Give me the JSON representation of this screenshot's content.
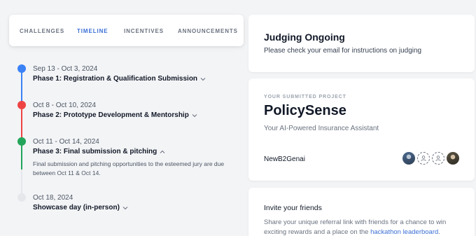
{
  "tabs": [
    {
      "label": "CHALLENGES",
      "active": false
    },
    {
      "label": "TIMELINE",
      "active": true
    },
    {
      "label": "INCENTIVES",
      "active": false
    },
    {
      "label": "ANNOUNCEMENTS",
      "active": false
    }
  ],
  "timeline": {
    "phases": [
      {
        "date": "Sep 13 - Oct 3, 2024",
        "title": "Phase 1: Registration & Qualification Submission",
        "status_color": "#3b82f6",
        "expanded": false
      },
      {
        "date": "Oct 8 - Oct 10, 2024",
        "title": "Phase 2: Prototype Development & Mentorship",
        "status_color": "#ef4444",
        "expanded": false
      },
      {
        "date": "Oct 11 - Oct 14, 2024",
        "title": "Phase 3: Final submission & pitching",
        "status_color": "#22a55a",
        "expanded": true,
        "description": "Final submission and pitching opportunities to the esteemed jury are due between Oct 11 & Oct 14."
      },
      {
        "date": "Oct 18, 2024",
        "title": "Showcase day (in-person)",
        "status_color": "#e5e7eb",
        "expanded": false
      }
    ]
  },
  "judging": {
    "title": "Judging Ongoing",
    "subtitle": "Please check your email for instructions on judging"
  },
  "project": {
    "label": "YOUR SUBMITTED PROJECT",
    "name": "PolicySense",
    "tagline": "Your AI-Powered Insurance Assistant",
    "team": "NewB2Genai",
    "avatars": [
      "photo",
      "placeholder",
      "placeholder",
      "photo"
    ]
  },
  "invite": {
    "title": "Invite your friends",
    "text_before": "Share your unique referral link with friends for a chance to win exciting rewards and a place on the ",
    "link_text": "hackathon leaderboard",
    "text_after": "."
  },
  "colors": {
    "accent": "#3b6fd6",
    "background": "#f3f4f6"
  }
}
